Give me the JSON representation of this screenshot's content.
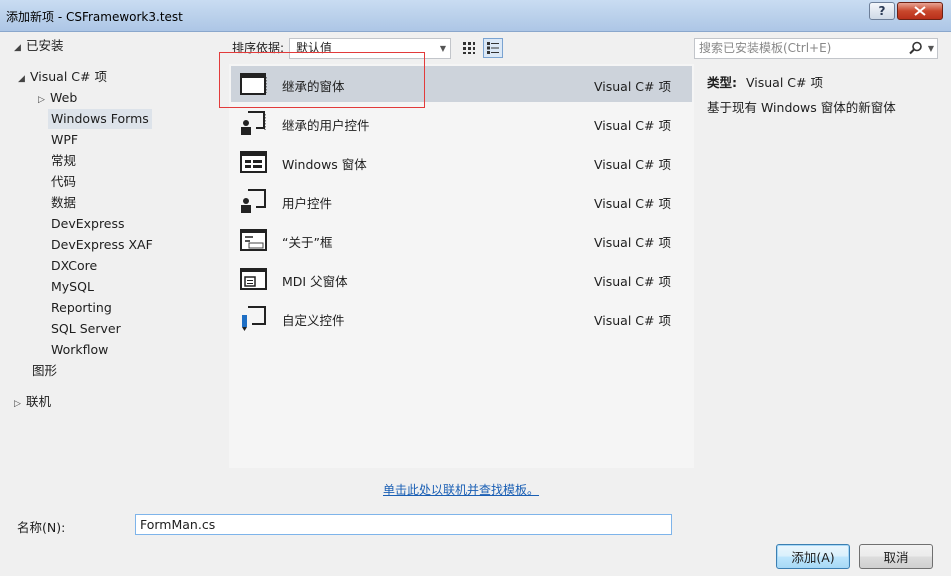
{
  "window": {
    "title": "添加新项 - CSFramework3.test",
    "help_button": "?",
    "close_button": "x"
  },
  "tree": {
    "root_installed": "已安装",
    "items": [
      {
        "label": "Visual C# 项",
        "arrow": "◢"
      },
      {
        "label": "Web",
        "arrow": "▷"
      },
      {
        "label": "Windows Forms",
        "arrow": ""
      },
      {
        "label": "WPF",
        "arrow": ""
      },
      {
        "label": "常规",
        "arrow": ""
      },
      {
        "label": "代码",
        "arrow": ""
      },
      {
        "label": "数据",
        "arrow": ""
      },
      {
        "label": "DevExpress",
        "arrow": ""
      },
      {
        "label": "DevExpress XAF",
        "arrow": ""
      },
      {
        "label": "DXCore",
        "arrow": ""
      },
      {
        "label": "MySQL",
        "arrow": ""
      },
      {
        "label": "Reporting",
        "arrow": ""
      },
      {
        "label": "SQL Server",
        "arrow": ""
      },
      {
        "label": "Workflow",
        "arrow": ""
      },
      {
        "label": "图形",
        "arrow": ""
      },
      {
        "label": "联机",
        "arrow": "▷"
      }
    ]
  },
  "toolbar": {
    "sort_label": "排序依据:",
    "sort_value": "默认值"
  },
  "templates": [
    {
      "name": "继承的窗体",
      "type": "Visual C# 项",
      "icon": "inherited-form-icon"
    },
    {
      "name": "继承的用户控件",
      "type": "Visual C# 项",
      "icon": "inherited-user-control-icon"
    },
    {
      "name": "Windows 窗体",
      "type": "Visual C# 项",
      "icon": "windows-form-icon"
    },
    {
      "name": "用户控件",
      "type": "Visual C# 项",
      "icon": "user-control-icon"
    },
    {
      "name": "“关于”框",
      "type": "Visual C# 项",
      "icon": "about-box-icon"
    },
    {
      "name": "MDI 父窗体",
      "type": "Visual C# 项",
      "icon": "mdi-parent-form-icon"
    },
    {
      "name": "自定义控件",
      "type": "Visual C# 项",
      "icon": "custom-control-icon"
    }
  ],
  "online_link": "单击此处以联机并查找模板。",
  "search": {
    "placeholder": "搜索已安装模板(Ctrl+E)"
  },
  "details": {
    "type_label": "类型:",
    "type_value": "Visual C# 项",
    "description": "基于现有 Windows 窗体的新窗体"
  },
  "bottom": {
    "name_label": "名称(N):",
    "name_value": "FormMan.cs",
    "add_button": "添加(A)",
    "cancel_button": "取消"
  },
  "colors": {
    "selection": "#cdd3db",
    "highlight_box": "#e23b3b",
    "link": "#1a5fb4"
  }
}
